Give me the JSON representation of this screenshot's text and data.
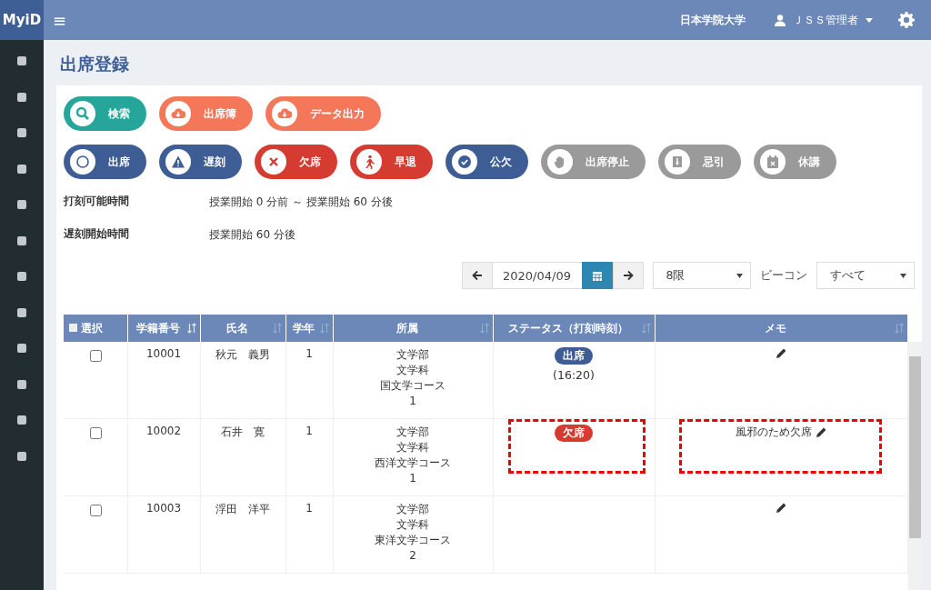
{
  "header": {
    "logo": "MyiD",
    "menu_icon": "≡",
    "organization": "日本学院大学",
    "user": "ＪＳＳ管理者"
  },
  "page_title": "出席登録",
  "action_buttons": [
    {
      "label": "検索",
      "color": "#26a69a"
    },
    {
      "label": "出席簿",
      "color": "#f4775a"
    },
    {
      "label": "データ出力",
      "color": "#f4775a"
    }
  ],
  "status_buttons": [
    {
      "label": "出席",
      "color": "#3d5d94"
    },
    {
      "label": "遅刻",
      "color": "#3d5d94"
    },
    {
      "label": "欠席",
      "color": "#d63b32"
    },
    {
      "label": "早退",
      "color": "#d63b32"
    },
    {
      "label": "公欠",
      "color": "#3d5d94"
    },
    {
      "label": "出席停止",
      "color": "#9a9a9a"
    },
    {
      "label": "忌引",
      "color": "#9a9a9a"
    },
    {
      "label": "休講",
      "color": "#9a9a9a"
    }
  ],
  "info": [
    {
      "label": "打刻可能時間",
      "value": "授業開始 0 分前 ～ 授業開始 60 分後"
    },
    {
      "label": "遅刻開始時間",
      "value": "授業開始 60 分後"
    }
  ],
  "filters": {
    "date": "2020/04/09",
    "period": "8限",
    "beacon_label": "ビーコン",
    "beacon": "すべて"
  },
  "table": {
    "columns": [
      "選択",
      "学籍番号",
      "氏名",
      "学年",
      "所属",
      "ステータス（打刻時刻）",
      "メモ"
    ],
    "rows": [
      {
        "checked": false,
        "highlighted": false,
        "id": "10001",
        "name": "秋元　義男",
        "year": "1",
        "affiliation": [
          "文学部",
          "文学科",
          "国文学コース",
          "1"
        ],
        "status": {
          "label": "出席",
          "color": "#3d5d94",
          "time": "(16:20)"
        },
        "memo": ""
      },
      {
        "checked": false,
        "highlighted": true,
        "id": "10002",
        "name": "石井　寛",
        "year": "1",
        "affiliation": [
          "文学部",
          "文学科",
          "西洋文学コース",
          "1"
        ],
        "status": {
          "label": "欠席",
          "color": "#d63b32"
        },
        "memo": "風邪のため欠席"
      },
      {
        "checked": false,
        "highlighted": false,
        "id": "10003",
        "name": "浮田　洋平",
        "year": "1",
        "affiliation": [
          "文学部",
          "文学科",
          "東洋文学コース",
          "2"
        ],
        "memo": ""
      }
    ]
  }
}
